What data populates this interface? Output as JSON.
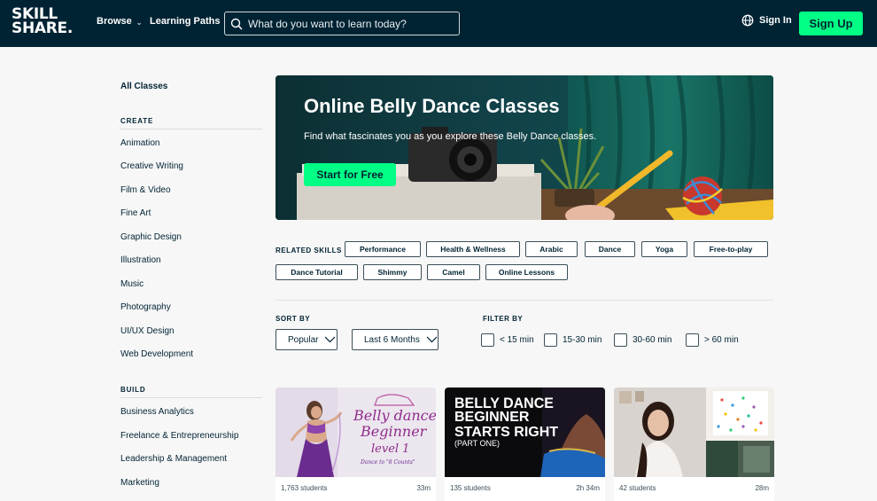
{
  "header": {
    "logo_line1": "SKILL",
    "logo_line2": "SHARE.",
    "browse_label": "Browse",
    "learning_paths_label": "Learning Paths",
    "search_placeholder": "What do you want to learn today?",
    "signin_label": "Sign In",
    "signup_label": "Sign Up"
  },
  "sidebar": {
    "all_classes": "All Classes",
    "create_heading": "CREATE",
    "create_items": [
      "Animation",
      "Creative Writing",
      "Film & Video",
      "Fine Art",
      "Graphic Design",
      "Illustration",
      "Music",
      "Photography",
      "UI/UX Design",
      "Web Development"
    ],
    "build_heading": "BUILD",
    "build_items": [
      "Business Analytics",
      "Freelance & Entrepreneurship",
      "Leadership & Management",
      "Marketing"
    ]
  },
  "hero": {
    "title": "Online Belly Dance Classes",
    "subtitle": "Find what fascinates you as you explore these Belly Dance classes.",
    "cta": "Start for Free"
  },
  "related": {
    "label": "RELATED SKILLS",
    "skills": [
      "Performance",
      "Health & Wellness",
      "Arabic",
      "Dance",
      "Yoga",
      "Free-to-play",
      "Dance Tutorial",
      "Shimmy",
      "Camel",
      "Online Lessons"
    ]
  },
  "sort": {
    "label": "SORT BY",
    "sort_value": "Popular",
    "period_value": "Last 6 Months"
  },
  "filter": {
    "label": "FILTER BY",
    "options": [
      "< 15 min",
      "15-30 min",
      "30-60 min",
      "> 60 min"
    ]
  },
  "cards": [
    {
      "thumb_line1": "Belly dance",
      "thumb_line2": "Beginner",
      "thumb_line3": "level 1",
      "thumb_line4": "Dance to \"8 Counts\"",
      "students": "1,763 students",
      "duration": "33m"
    },
    {
      "thumb_line1": "BELLY DANCE",
      "thumb_line2": "BEGINNER",
      "thumb_line3": "STARTS RIGHT",
      "thumb_line4": "(PART ONE)",
      "students": "135 students",
      "duration": "2h 34m"
    },
    {
      "students": "42 students",
      "duration": "28m"
    }
  ],
  "colors": {
    "header_bg": "#002333",
    "accent_green": "#00ff84",
    "text_dark": "#002333"
  }
}
